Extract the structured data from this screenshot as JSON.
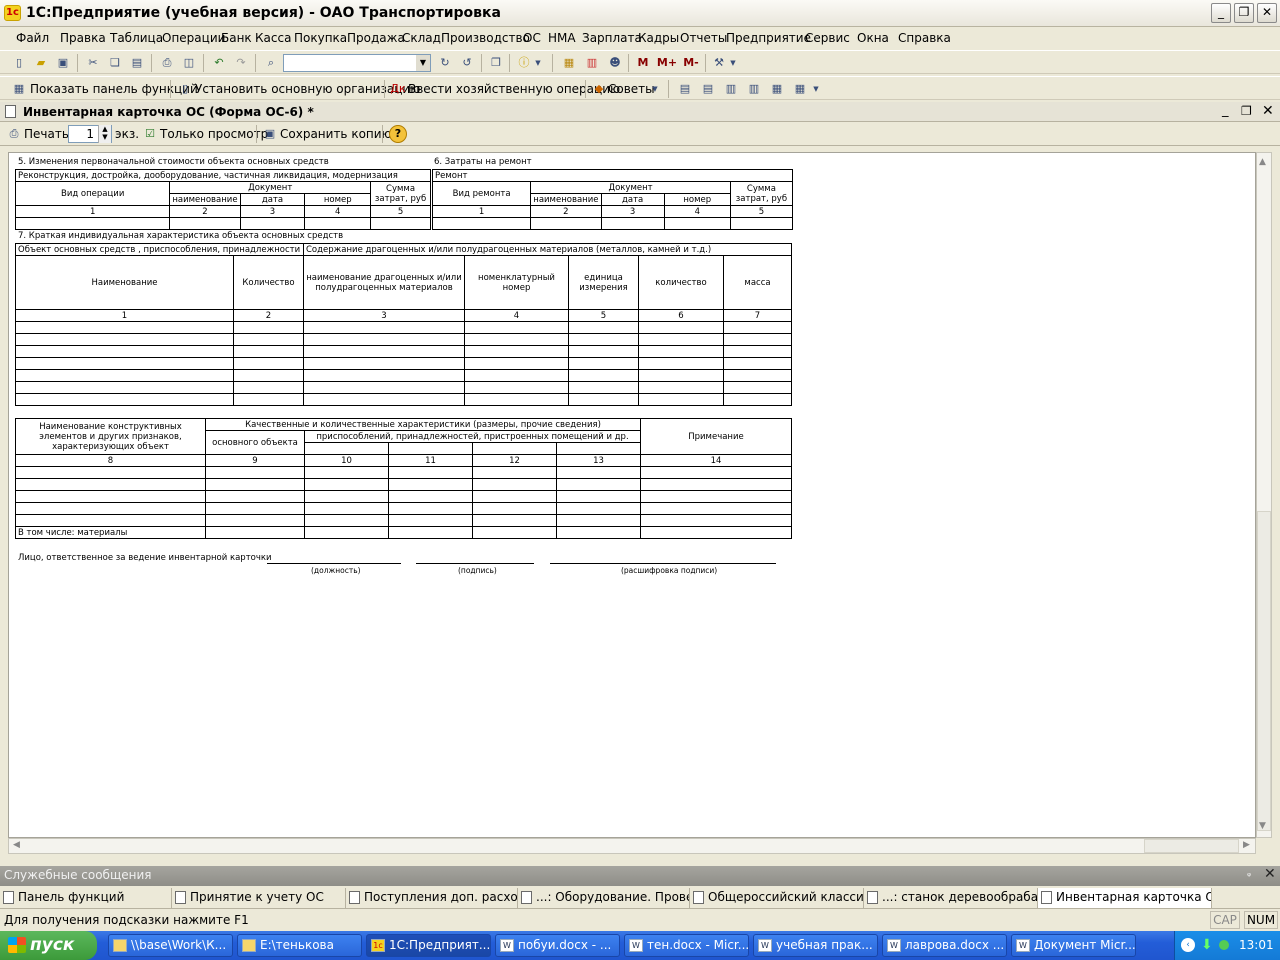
{
  "app": {
    "title": "1С:Предприятие (учебная версия) - ОАО Транспортировка"
  },
  "menu": [
    "Файл",
    "Правка",
    "Таблица",
    "Операции",
    "Банк",
    "Касса",
    "Покупка",
    "Продажа",
    "Склад",
    "Производство",
    "ОС",
    "НМА",
    "Зарплата",
    "Кадры",
    "Отчеты",
    "Предприятие",
    "Сервис",
    "Окна",
    "Справка"
  ],
  "toolbar2": {
    "show_panel": "Показать панель функций",
    "set_org": "Установить основную организацию",
    "enter_op": "Ввести хозяйственную операцию",
    "tips": "Советы"
  },
  "document": {
    "title": "Инвентарная карточка ОС (Форма ОС-6) *",
    "print": "Печать",
    "copies": "1",
    "copies_unit": "экз.",
    "preview_only": "Только просмотр",
    "save_copy": "Сохранить копию..."
  },
  "form": {
    "s5_title": "5. Изменения первоначальной стоимости объекта основных средств",
    "s5_sub": "Реконструкция, достройка, дооборудование, частичная ликвидация, модернизация",
    "s5_optype": "Вид операции",
    "s5_doc": "Документ",
    "s5_name": "наименование",
    "s5_date": "дата",
    "s5_num": "номер",
    "s5_sum": "Сумма затрат, руб",
    "s6_title": "6. Затраты на ремонт",
    "s6_sub": "Ремонт",
    "s6_type": "Вид ремонта",
    "n1": "1",
    "n2": "2",
    "n3": "3",
    "n4": "4",
    "n5": "5",
    "n6": "6",
    "n7": "7",
    "n8": "8",
    "n9": "9",
    "n10": "10",
    "n11": "11",
    "n12": "12",
    "n13": "13",
    "n14": "14",
    "s7_title": "7. Краткая индивидуальная характеристика объекта основных средств",
    "s7_obj": "Объект основных средств , приспособления, принадлежности",
    "s7_cont": "Содержание драгоценных и/или полудрагоценных материалов (металлов, камней и т.д.)",
    "s7_h_name": "Наименование",
    "s7_h_qty": "Количество",
    "s7_h_prec": "наименование драгоценных и/или полудрагоценных материалов",
    "s7_h_nom": "номенклатурный номер",
    "s7_h_unit": "единица измерения",
    "s7_h_qty2": "количество",
    "s7_h_mass": "масса",
    "t3_h1": "Наименование конструктивных элементов и других признаков, характеризующих объект",
    "t3_h2": "Качественные и количественные характеристики (размеры, прочие сведения)",
    "t3_h3": "основного объекта",
    "t3_h4": "приспособлений, принадлежностей,  пристроенных помещений и др.",
    "t3_h5": "Примечание",
    "t3_incl": "В том числе: материалы",
    "resp": "Лицо, ответственное за ведение инвентарной карточки",
    "sig_pos": "(должность)",
    "sig_sign": "(подпись)",
    "sig_decode": "(расшифровка подписи)"
  },
  "service_messages": "Служебные сообщения",
  "window_tabs": [
    "Панель функций",
    "Принятие к учету ОС",
    "Поступления доп. расходов",
    "...: Оборудование. Проведен",
    "Общероссийский классиф...",
    "...: станок деревообрабаты...",
    "Инвентарная карточка ОС (..."
  ],
  "status": {
    "hint": "Для получения подсказки нажмите F1",
    "cap": "CAP",
    "num": "NUM"
  },
  "taskbar": {
    "start": "пуск",
    "items": [
      "\\\\base\\Work\\К...",
      "E:\\тенькова",
      "1С:Предприят...",
      "побуи.docx - ...",
      "тен.docx - Micr...",
      "учебная прак...",
      "лаврова.docx ...",
      "Документ Micr..."
    ],
    "clock": "13:01"
  }
}
